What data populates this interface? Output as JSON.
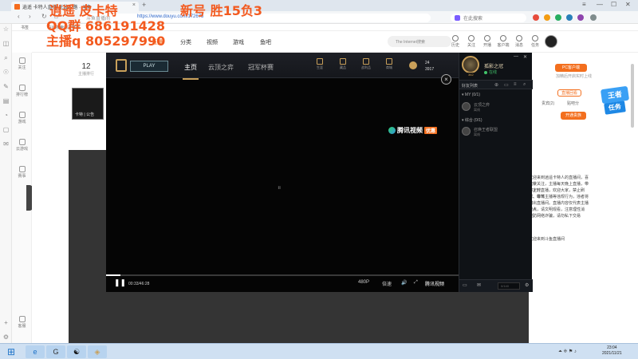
{
  "browser": {
    "tab_title": "逍遥 卡特人直播 无敌中路 · 斗鱼",
    "tab_close": "×",
    "tab_add": "+",
    "window_controls": [
      "≡",
      "—",
      "☐",
      "✕"
    ],
    "url_prefix": "斗鱼直播间",
    "url": "https://www.douyu.com/172675",
    "search_placeholder": "在此搜索",
    "nav": {
      "back": "‹",
      "forward": "›",
      "refresh": "↻",
      "home": "⌂"
    },
    "bookmarks": [
      "书签",
      "在此搜索的是推荐"
    ],
    "sidebar_icons": [
      "☆",
      "◫",
      "⌕",
      "☉",
      "✎",
      "▤",
      "◔",
      "▢",
      "✉",
      "⚙"
    ],
    "bottom_icons": [
      "+",
      "⚙"
    ]
  },
  "overlay": {
    "line1": "逍遥 皮卡特",
    "line2": "新号 胜15负3",
    "line3": "QQ群 686191428",
    "line4": "主播q 805297990"
  },
  "douyu_nav": {
    "items": [
      "关注",
      "排行榜",
      "游戏",
      "云游戏",
      "赛事",
      "客服"
    ]
  },
  "douyu_header": {
    "live_label": "直播",
    "menu": [
      "分类",
      "视频",
      "游戏",
      "鱼吧"
    ],
    "search_hint": "The Internet搜索",
    "icons": [
      "历史",
      "关注",
      "开播",
      "客户端",
      "消息",
      "任务"
    ]
  },
  "room": {
    "follow_count": "12",
    "follow_label": "主播排行",
    "thumb_caption": "卡特 | 公告"
  },
  "right_panel": {
    "pc_button": "PC客户端",
    "pc_sub": "加精后开启实时上线",
    "tabs": [
      "贵宾(2)",
      "贴吧分"
    ],
    "open_button": "开通贵族",
    "rank_label": "直播回看",
    "desc_lines": [
      "欢迎来到逍遥卡特人的直播间，喜欢就",
      "点个关注，主播每天晚上直播，带你上分，",
      "不定时直播，欢迎大家，禁止刷屏、带节",
      "奏、辱骂主播等违规行为，违者将被",
      "踢出直播间。直播内容仅代表主播个人",
      "观点，请文明观看，注意理性消费，",
      "谨防网络诈骗，请勿私下交易",
      "欢迎来到斗鱼直播间"
    ],
    "promo_top": "王者",
    "promo_bottom": "任务"
  },
  "player": {
    "play_button": "PLAY",
    "tabs": [
      "主页",
      "云顶之弈",
      "冠军杯赛"
    ],
    "icons": [
      "生涯",
      "藏品",
      "战利品",
      "商城"
    ],
    "currency_be": "24",
    "currency_rp": "3917",
    "watermark": "腾讯视频",
    "watermark_badge": "优惠",
    "center_icon": "⏸",
    "progress": 0.04,
    "time": "00:33/46:28",
    "quality": "480P",
    "speed": "倍速",
    "brand": "腾讯视频",
    "ctrl_icons": [
      "🔊",
      "⤢",
      "⛶"
    ]
  },
  "lol_client": {
    "summoner_name": "孤影之冠",
    "status": "在线",
    "level": "362",
    "friends_header": "好友列表",
    "group1": "▾ MY (0/1)",
    "friend1_name": "云顶之弈",
    "friend1_status": "离线",
    "group2": "▾ 综合 (0/1)",
    "friend2_name": "召唤王者联盟",
    "friend2_status": "离线",
    "window_controls": [
      "—",
      "✕"
    ],
    "close_overlay": "×",
    "chat_placeholder": "0/140",
    "bottom_icons": [
      "▭",
      "✉",
      "⚙"
    ]
  },
  "taskbar": {
    "start": "⊞",
    "apps": [
      "e",
      "G",
      "☯",
      "◈"
    ],
    "tray": "⏶ ◈ ⚑ ♪",
    "time": "23:04",
    "date": "2021/11/21"
  }
}
